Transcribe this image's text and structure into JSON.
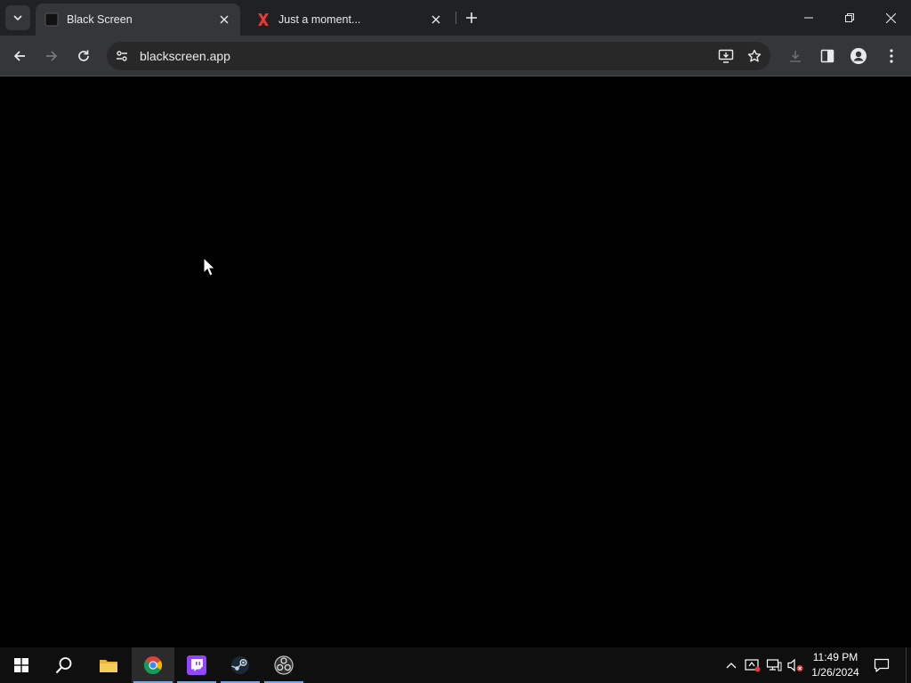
{
  "browser": {
    "tabs": [
      {
        "title": "Black Screen",
        "active": true,
        "favicon": "black-square-icon"
      },
      {
        "title": "Just a moment...",
        "active": false,
        "favicon": "x-logo-icon"
      }
    ],
    "url": "blackscreen.app"
  },
  "taskbar": {
    "apps": [
      "windows-start-icon",
      "search-icon",
      "file-explorer-icon",
      "chrome-icon",
      "twitch-icon",
      "steam-icon",
      "obs-icon"
    ],
    "active_app": "chrome-icon"
  },
  "clock": {
    "time": "11:49 PM",
    "date": "1/26/2024"
  },
  "colors": {
    "tabstrip": "#202124",
    "toolbar": "#35363a",
    "content": "#000000",
    "taskbar": "#0f0f0f",
    "x_logo": "#e53935",
    "twitch": "#9146ff"
  }
}
